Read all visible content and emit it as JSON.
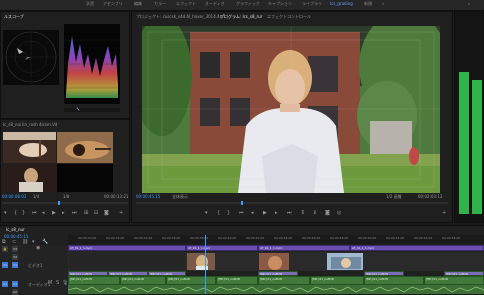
{
  "workspaces": [
    "学習",
    "アセンブリ",
    "編集",
    "カラー",
    "エフェクト",
    "オーディオ",
    "グラフィック",
    "キャプション",
    "ライブラリ",
    "lcs_grading",
    "新規"
  ],
  "active_workspace_index": 9,
  "left_top_panel": {
    "tab_label": "ルスコープ"
  },
  "source_panel": {
    "clip_name": "lc_s8_noi lln_rosh 4icsm.Vd",
    "timecode_in": "00:00:08:03",
    "quality": "1/8",
    "timecode_out": "00:00:13:21",
    "page": "1/4"
  },
  "program_panel": {
    "tabs": [
      "プロジェクト: cuscsk_s4d.6l_hover_3014.4e.1.",
      "プログラム: lcs_s8_rur",
      "エフェクトコントロール"
    ],
    "active_tab_index": 1,
    "timecode": "00:00:45:15",
    "fit": "全体表示",
    "quality": "1/2 画質",
    "duration": "00:02:03:13"
  },
  "timeline": {
    "sequence_name": "lc_s8_nur",
    "timecode": "00:00:45:15",
    "ruler_labels": [
      "00:00:30:00",
      "00:00:32:00",
      "00:00:34:00",
      "00:00:36:00",
      "00:00:38:00",
      "00:00:40:00",
      "00:00:42:00",
      "00:00:44:00",
      "00:00:46:00",
      "00:00:48:00",
      "00:00:50:00",
      "00:00:52:00",
      "00:00:54:00",
      "00:00:56:00"
    ],
    "tracks": [
      "V3",
      "V2",
      "V1",
      "A1",
      "A2",
      "A3"
    ],
    "track_labels": {
      "video_name": "ビデオ1",
      "audio_name": "オーディオ1"
    },
    "adjustment_clips": [
      "AT_01_1_1.mp4",
      "AT_01_1_1.mp4",
      "AT_01_1_1.mp4",
      "AT_01_1_1.mp4"
    ],
    "video_clips": [
      "[MC] 01_nuM.W",
      "[MC] 01_nuM.W",
      "[MC] 01_nuM.W",
      "[MC] 01_nuM.W",
      "[MC] 01_nuM.W",
      "[MC] 01_nuM.W"
    ],
    "audio_clips": [
      "[MC] 01_nuM.W",
      "[MC] 01_nuM.W",
      "[MC] 01_nuM.W",
      "[MC] 01_nuM.W",
      "[MC] 01_nuM.W",
      "[MC] 01_nuM.W",
      "[MC] 01_nuM.W",
      "[MC] 01_nuM.W"
    ]
  },
  "colors": {
    "accent_blue": "#3f9cff",
    "clip_purple": "#6a4fb0",
    "audio_green": "#3f7a3a",
    "meter_green": "#2fb34a"
  }
}
